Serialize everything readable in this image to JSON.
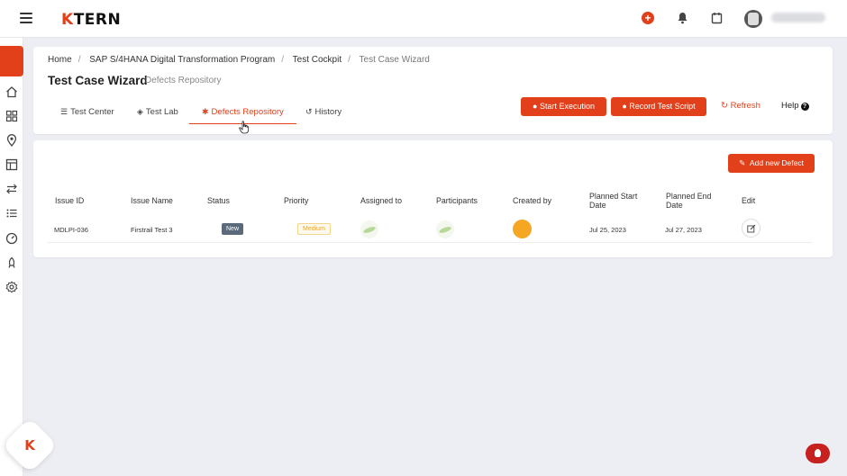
{
  "app": {
    "logo": "KTERN"
  },
  "breadcrumb": [
    "Home",
    "SAP S/4HANA Digital Transformation Program",
    "Test Cockpit",
    "Test Case Wizard"
  ],
  "page": {
    "title": "Test Case Wizard",
    "subtitle": "Defects Repository"
  },
  "tabs": [
    {
      "label": "Test Center",
      "icon": "list-icon"
    },
    {
      "label": "Test Lab",
      "icon": "cube-icon"
    },
    {
      "label": "Defects Repository",
      "icon": "bug-icon",
      "active": true
    },
    {
      "label": "History",
      "icon": "history-icon"
    }
  ],
  "actions": {
    "start_execution": "Start Execution",
    "record_test_script": "Record Test Script",
    "refresh": "Refresh",
    "help": "Help"
  },
  "defects": {
    "add_button": "Add new Defect",
    "columns": [
      "Issue ID",
      "Issue Name",
      "Status",
      "Priority",
      "Assigned to",
      "Participants",
      "Created by",
      "Planned Start Date",
      "Planned End Date",
      "Edit"
    ],
    "rows": [
      {
        "issue_id": "MDLPI-036",
        "issue_name": "Firstrail Test 3",
        "status": "New",
        "priority": "Medium",
        "planned_start": "Jul 25, 2023",
        "planned_end": "Jul 27, 2023"
      }
    ]
  },
  "colors": {
    "accent": "#e2401b",
    "status_new": "#5a6a7a",
    "priority_medium": "#e5a628",
    "creator_avatar": "#f5a623"
  }
}
